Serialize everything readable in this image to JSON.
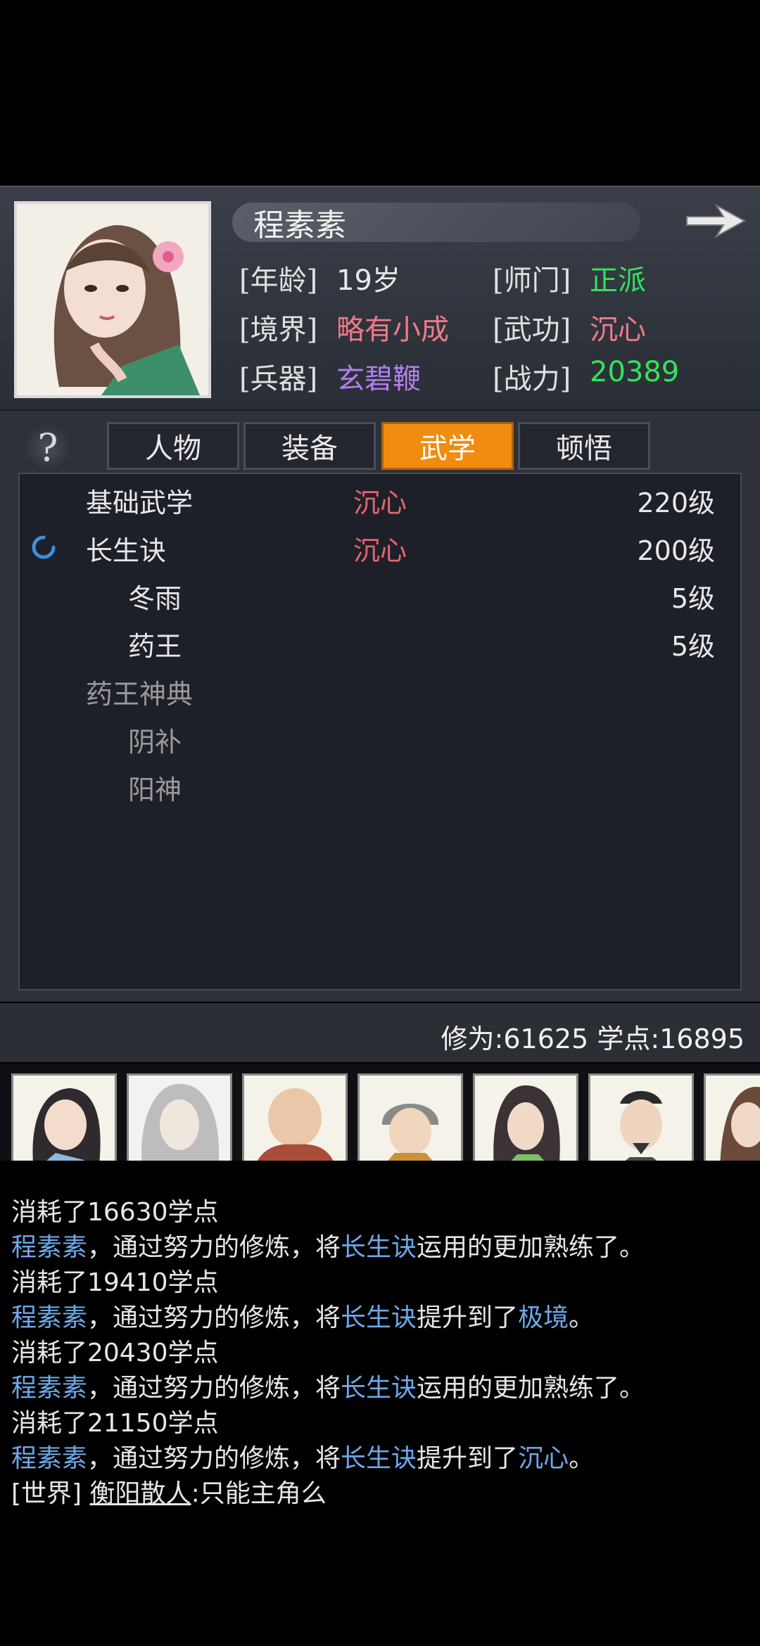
{
  "character": {
    "name": "程素素",
    "attributes": [
      {
        "label": "[年龄]",
        "value": "19岁",
        "color": "#e8e8e8"
      },
      {
        "label": "[师门]",
        "value": "正派",
        "color": "#34e25a"
      },
      {
        "label": "[境界]",
        "value": "略有小成",
        "color": "#f07a86"
      },
      {
        "label": "[武功]",
        "value": "沉心",
        "color": "#f07a86"
      },
      {
        "label": "[兵器]",
        "value": "玄碧鞭",
        "color": "#b27ef0"
      },
      {
        "label": "[战力]",
        "value": "20389",
        "color": "#34e25a"
      }
    ],
    "portrait_icon": "portrait-woman-icon",
    "next_icon": "arrow-right-icon"
  },
  "tabs": [
    {
      "label": "人物",
      "active": false
    },
    {
      "label": "装备",
      "active": false
    },
    {
      "label": "武学",
      "active": true
    },
    {
      "label": "顿悟",
      "active": false
    }
  ],
  "help": "?",
  "skills": [
    {
      "name": "基础武学",
      "state": "沉心",
      "level": "220级",
      "indent": false,
      "dim": false,
      "loading": false
    },
    {
      "name": "长生诀",
      "state": "沉心",
      "level": "200级",
      "indent": false,
      "dim": false,
      "loading": true
    },
    {
      "name": "冬雨",
      "state": "",
      "level": "5级",
      "indent": true,
      "dim": false,
      "loading": false
    },
    {
      "name": "药王",
      "state": "",
      "level": "5级",
      "indent": true,
      "dim": false,
      "loading": false
    },
    {
      "name": "药王神典",
      "state": "",
      "level": "",
      "indent": false,
      "dim": true,
      "loading": false
    },
    {
      "name": "阴补",
      "state": "",
      "level": "",
      "indent": true,
      "dim": true,
      "loading": false
    },
    {
      "name": "阳神",
      "state": "",
      "level": "",
      "indent": true,
      "dim": true,
      "loading": false
    }
  ],
  "stats": "修为:61625  学点:16895",
  "avatars": [
    "avatar-1",
    "avatar-2",
    "avatar-3",
    "avatar-4",
    "avatar-5",
    "avatar-6",
    "avatar-7"
  ],
  "log": {
    "line1": "消耗了16630学点",
    "line2": {
      "a": "程素素",
      "b": "，通过努力的修炼，将",
      "c": "长生诀",
      "d": "运用的更加熟练了。"
    },
    "line3": "消耗了19410学点",
    "line4": {
      "a": "程素素",
      "b": "，通过努力的修炼，将",
      "c": "长生诀",
      "d": "提升到了",
      "e": "极境",
      "f": "。"
    },
    "line5": "消耗了20430学点",
    "line6": {
      "a": "程素素",
      "b": "，通过努力的修炼，将",
      "c": "长生诀",
      "d": "运用的更加熟练了。"
    },
    "line7": "消耗了21150学点",
    "line8": {
      "a": "程素素",
      "b": "，通过努力的修炼，将",
      "c": "长生诀",
      "d": "提升到了",
      "e": "沉心",
      "f": "。"
    },
    "world": {
      "tag": "[世界]",
      "user": "衡阳散人",
      "msg": ":只能主角么"
    }
  }
}
